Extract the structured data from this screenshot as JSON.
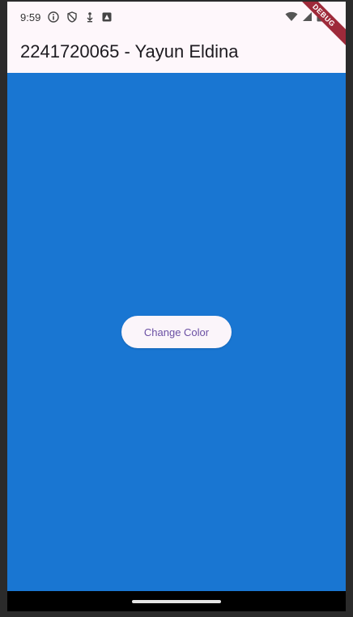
{
  "status_bar": {
    "time": "9:59",
    "left_icons": [
      "info-icon",
      "shield-icon",
      "download-icon",
      "app-icon"
    ],
    "right_icons": [
      "wifi-icon",
      "signal-icon",
      "battery-icon"
    ]
  },
  "app_bar": {
    "title": "2241720065 - Yayun Eldina",
    "background": "#fef7fb"
  },
  "debug_banner": {
    "label": "DEBUG",
    "color": "#9e2a3a"
  },
  "content": {
    "background": "#1976d2",
    "button_label": "Change Color",
    "button_text_color": "#6a4fa3"
  },
  "nav_bar": {
    "background": "#000000",
    "home_indicator": "home-indicator"
  }
}
